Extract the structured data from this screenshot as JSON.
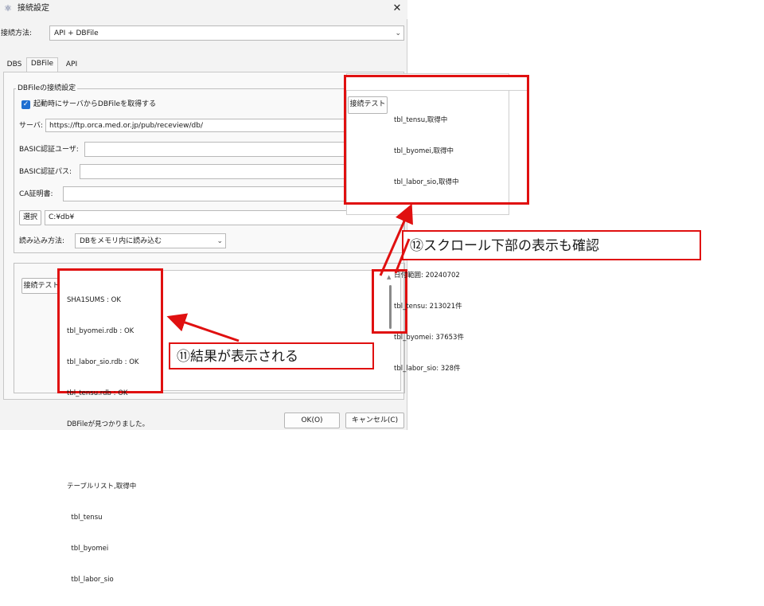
{
  "window": {
    "title": "接続設定",
    "close_icon": "close-icon"
  },
  "connection": {
    "label": "接続方法:",
    "value": "API + DBFile"
  },
  "tabs": [
    {
      "label": "DBS"
    },
    {
      "label": "DBFile"
    },
    {
      "label": "API"
    }
  ],
  "dbfile": {
    "group_title": "DBFileの接続設定",
    "auto_fetch_label": "起動時にサーバからDBFileを取得する",
    "server_label": "サーバ:",
    "server_value": "https://ftp.orca.med.or.jp/pub/receview/db/",
    "basic_user_label": "BASIC認証ユーザ:",
    "basic_pass_label": "BASIC認証パス:",
    "ca_label": "CA証明書:",
    "select_button": "選択",
    "path_value": "C:¥db¥",
    "load_label": "読み込み方法:",
    "load_value": "DBをメモリ内に読み込む",
    "test_button": "接続テスト",
    "result_lines": [
      "SHA1SUMS : OK",
      "tbl_byomei.rdb : OK",
      "tbl_labor_sio.rdb : OK",
      "tbl_tensu.rdb : OK",
      "DBFileが見つかりました。",
      "",
      "テーブルリスト,取得中",
      "  tbl_tensu",
      "  tbl_byomei",
      "  tbl_labor_sio"
    ]
  },
  "zoom": {
    "test_button": "接続テスト",
    "lines": [
      "tbl_tensu,取得中",
      "tbl_byomei,取得中",
      "tbl_labor_sio,取得中",
      "",
      "",
      "日付範囲: 20240702",
      "tbl_tensu: 213021件",
      "tbl_byomei: 37653件",
      "tbl_labor_sio: 328件"
    ]
  },
  "footer": {
    "ok": "OK(O)",
    "cancel": "キャンセル(C)"
  },
  "annotations": {
    "note11": "⑪結果が表示される",
    "note12": "⑫スクロール下部の表示も確認"
  },
  "colors": {
    "annotation_red": "#e01010",
    "checkbox_blue": "#1f6fd1"
  }
}
